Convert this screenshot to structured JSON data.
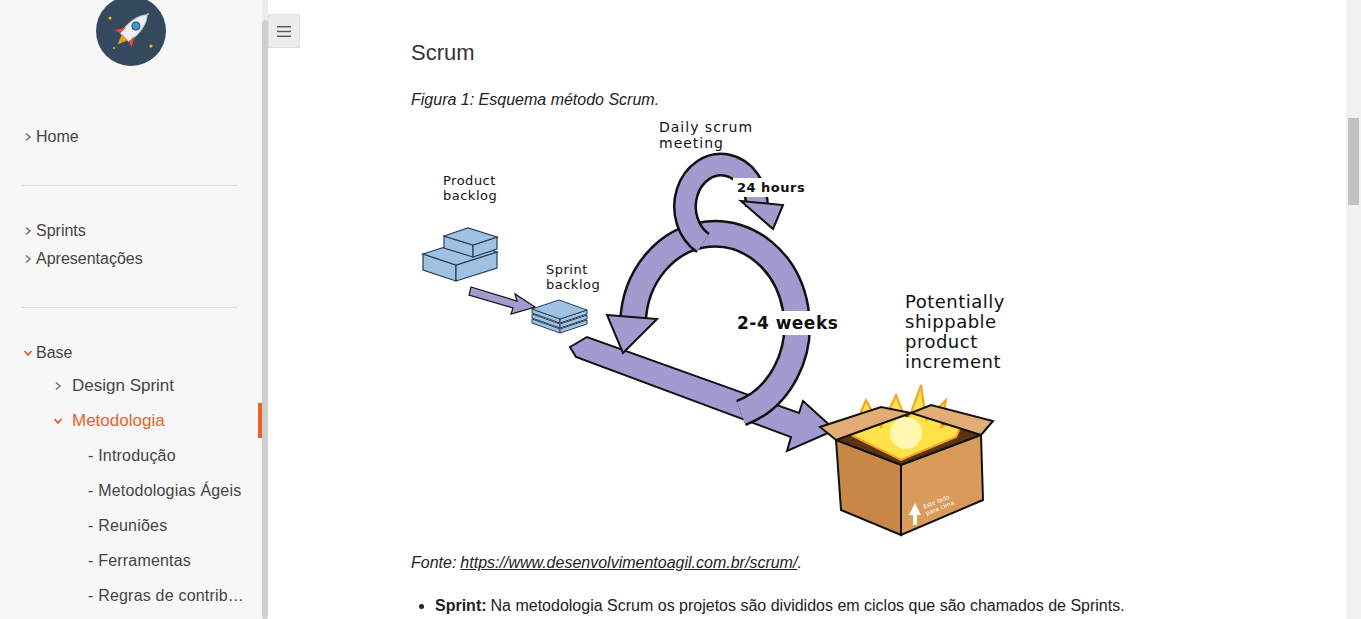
{
  "sidebar": {
    "groups": [
      {
        "items": [
          {
            "label": "Home",
            "kind": "branch",
            "expanded": false,
            "selected": false
          }
        ]
      },
      {
        "items": [
          {
            "label": "Sprints",
            "kind": "branch",
            "expanded": false,
            "selected": false
          },
          {
            "label": "Apresentações",
            "kind": "branch",
            "expanded": false,
            "selected": false
          }
        ]
      },
      {
        "items": [
          {
            "label": "Base",
            "kind": "branch",
            "expanded": true,
            "selected": false,
            "children": [
              {
                "label": "Design Sprint",
                "kind": "branch",
                "expanded": false,
                "selected": false
              },
              {
                "label": "Metodologia",
                "kind": "branch",
                "expanded": true,
                "selected": true,
                "children": [
                  {
                    "label": "- Introdução",
                    "kind": "leaf",
                    "selected": false
                  },
                  {
                    "label": "- Metodologias Ágeis",
                    "kind": "leaf",
                    "selected": false
                  },
                  {
                    "label": "- Reuniões",
                    "kind": "leaf",
                    "selected": false
                  },
                  {
                    "label": "- Ferramentas",
                    "kind": "leaf",
                    "selected": false
                  },
                  {
                    "label": "- Regras de contrib…",
                    "kind": "leaf",
                    "selected": false
                  }
                ]
              }
            ]
          }
        ]
      }
    ]
  },
  "content": {
    "heading": "Scrum",
    "caption": "Figura 1: Esquema método Scrum.",
    "figure": {
      "labels": [
        {
          "lines": [
            "Daily scrum",
            "meeting"
          ]
        },
        {
          "lines": [
            "24 hours"
          ]
        },
        {
          "lines": [
            "Product",
            "backlog"
          ]
        },
        {
          "lines": [
            "Sprint",
            "backlog"
          ]
        },
        {
          "lines": [
            "2-4 weeks"
          ]
        },
        {
          "lines": [
            "Potentially",
            "shippable",
            "product",
            "increment"
          ]
        }
      ],
      "box_text": "Este lado para cima"
    },
    "source": {
      "prefix": "Fonte:",
      "link": "https://www.desenvolvimentoagil.com.br/scrum/",
      "suffix": "."
    },
    "bullets": [
      {
        "term": "Sprint:",
        "text": "Na metodologia Scrum os projetos são divididos em ciclos que são chamados de Sprints."
      }
    ]
  }
}
